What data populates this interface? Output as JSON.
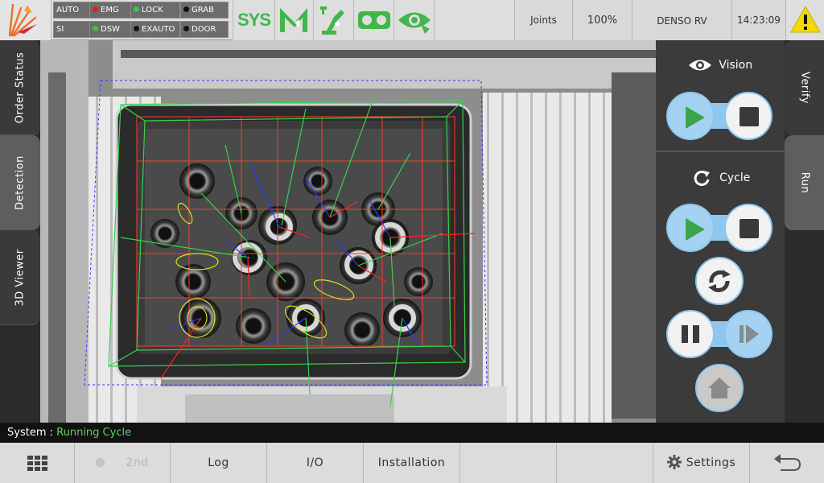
{
  "topbar": {
    "status_flags": {
      "auto": {
        "label": "AUTO",
        "color": ""
      },
      "si": {
        "label": "SI",
        "color": ""
      },
      "emg": {
        "label": "EMG",
        "color": "#e02020"
      },
      "dsw": {
        "label": "DSW",
        "color": "#3fc24a"
      },
      "lock": {
        "label": "LOCK",
        "color": "#3fc24a"
      },
      "exauto": {
        "label": "EXAUTO",
        "color": "#111111"
      },
      "grab": {
        "label": "GRAB",
        "color": "#111111"
      },
      "door": {
        "label": "DOOR",
        "color": "#111111"
      }
    },
    "sys_label": "SYS",
    "joints_label": "Joints",
    "speed": "100%",
    "robot_name": "DENSO RV",
    "clock": "14:23:09",
    "accent_green": "#42b64b",
    "warning_color": "#f5d800"
  },
  "left_tabs": {
    "order_status": "Order Status",
    "detection": "Detection",
    "viewer_3d": "3D Viewer"
  },
  "right_tabs": {
    "verify": "Verify",
    "run": "Run"
  },
  "control_panel": {
    "vision_title": "Vision",
    "cycle_title": "Cycle",
    "toggle_color": "#8ec6ee",
    "play_color": "#3aa64c"
  },
  "status": {
    "label": "System",
    "separator": ":",
    "value": "Running Cycle",
    "value_color": "#5fd35a"
  },
  "bottombar": {
    "second_label": "2nd",
    "log_label": "Log",
    "io_label": "I/O",
    "installation_label": "Installation",
    "settings_label": "Settings"
  }
}
